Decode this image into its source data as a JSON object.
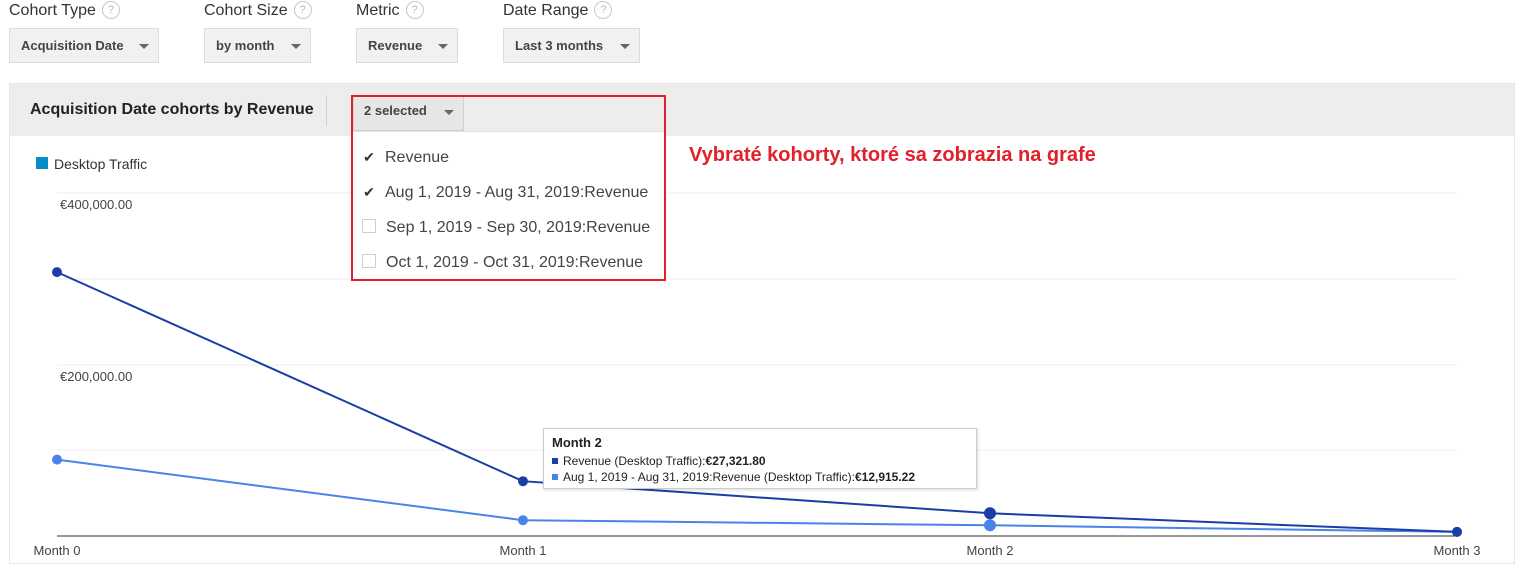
{
  "controls": {
    "cohort_type": {
      "label": "Cohort Type",
      "value": "Acquisition Date"
    },
    "cohort_size": {
      "label": "Cohort Size",
      "value": "by month"
    },
    "metric": {
      "label": "Metric",
      "value": "Revenue"
    },
    "date_range": {
      "label": "Date Range",
      "value": "Last 3 months"
    }
  },
  "help_glyph": "?",
  "panel": {
    "title": "Acquisition Date cohorts by Revenue",
    "multi_select_label": "2 selected",
    "options": [
      {
        "label": "Revenue",
        "checked": true
      },
      {
        "label": "Aug 1, 2019 - Aug 31, 2019:Revenue",
        "checked": true
      },
      {
        "label": "Sep 1, 2019 - Sep 30, 2019:Revenue",
        "checked": false
      },
      {
        "label": "Oct 1, 2019 - Oct 31, 2019:Revenue",
        "checked": false
      }
    ]
  },
  "annotation": "Vybraté kohorty, ktoré sa zobrazia na grafe",
  "legend": {
    "label": "Desktop Traffic",
    "color": "#058dc7"
  },
  "chart_data": {
    "type": "line",
    "categories": [
      "Month 0",
      "Month 1",
      "Month 2",
      "Month 3"
    ],
    "y_ticks": [
      "€400,000.00",
      "€200,000.00"
    ],
    "ylim": [
      0,
      400000
    ],
    "series": [
      {
        "name": "Revenue",
        "color": "#1a3ea6",
        "values": [
          318000,
          66000,
          27321.8,
          5000
        ]
      },
      {
        "name": "Aug 1, 2019 - Aug 31, 2019:Revenue",
        "color": "#4a84e8",
        "values": [
          92000,
          19000,
          12915.22,
          5000
        ]
      }
    ],
    "grid": true
  },
  "tooltip": {
    "title": "Month 2",
    "rows": [
      {
        "label": "Revenue (Desktop Traffic):",
        "value": "€27,321.80",
        "color": "#1a3ea6"
      },
      {
        "label": "Aug 1, 2019 - Aug 31, 2019:Revenue (Desktop Traffic):",
        "value": "€12,915.22",
        "color": "#4a84e8"
      }
    ]
  }
}
